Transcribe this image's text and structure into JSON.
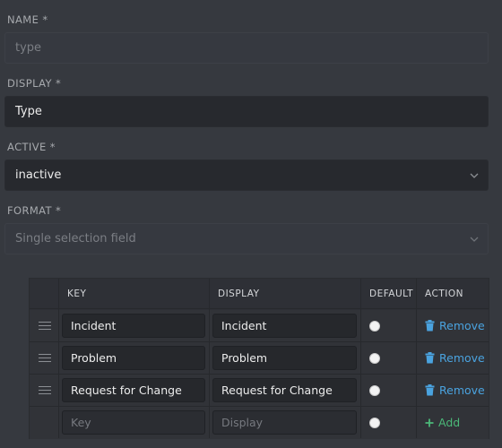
{
  "form": {
    "name": {
      "label": "NAME *",
      "placeholder": "type"
    },
    "display": {
      "label": "DISPLAY *",
      "value": "Type"
    },
    "active": {
      "label": "ACTIVE *",
      "value": "inactive"
    },
    "format": {
      "label": "FORMAT *",
      "placeholder": "Single selection field"
    }
  },
  "table": {
    "headers": {
      "key": "KEY",
      "display": "DISPLAY",
      "default": "DEFAULT",
      "action": "ACTION"
    },
    "rows": [
      {
        "key": "Incident",
        "display": "Incident",
        "action": "Remove"
      },
      {
        "key": "Problem",
        "display": "Problem",
        "action": "Remove"
      },
      {
        "key": "Request for Change",
        "display": "Request for Change",
        "action": "Remove"
      }
    ],
    "new_row": {
      "key_placeholder": "Key",
      "display_placeholder": "Display",
      "action": "Add"
    }
  },
  "colors": {
    "remove": "#4aa3df",
    "add": "#4bb878"
  }
}
